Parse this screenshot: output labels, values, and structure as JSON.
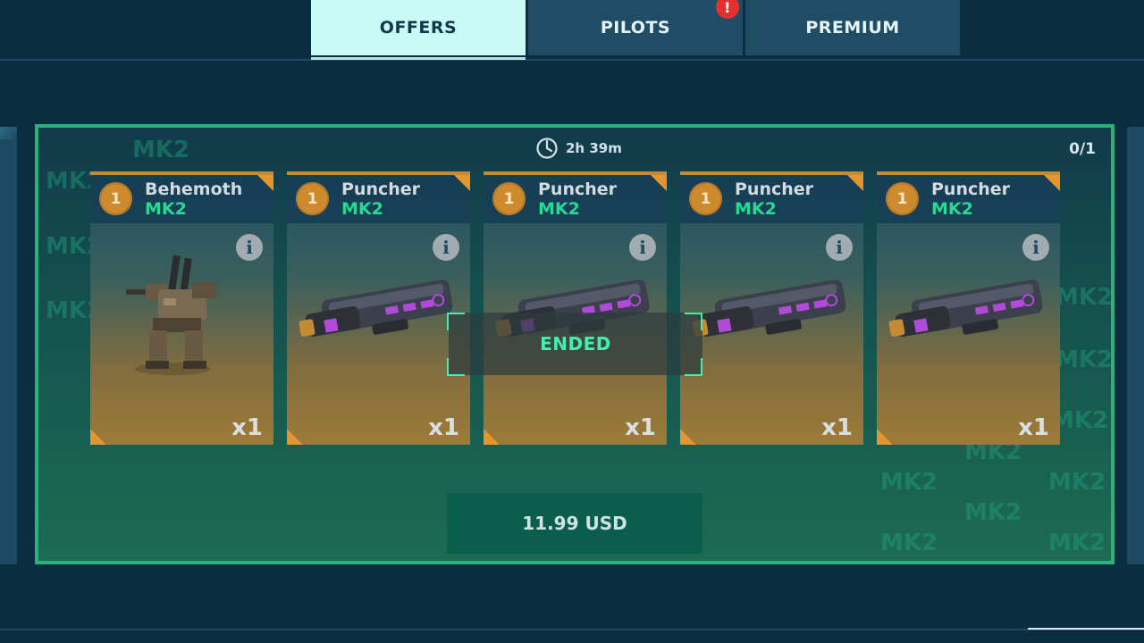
{
  "tabs": [
    {
      "label": "OFFERS",
      "active": true
    },
    {
      "label": "PILOTS",
      "active": false,
      "badge": "!"
    },
    {
      "label": "PREMIUM",
      "active": false
    }
  ],
  "offer": {
    "timer": "2h 39m",
    "counter": "0/1",
    "watermark": "MK2",
    "status": "ENDED",
    "price": "11.99 USD",
    "items": [
      {
        "level": "1",
        "name": "Behemoth",
        "tier": "MK2",
        "quantity": "x1",
        "kind": "robot"
      },
      {
        "level": "1",
        "name": "Puncher",
        "tier": "MK2",
        "quantity": "x1",
        "kind": "weapon"
      },
      {
        "level": "1",
        "name": "Puncher",
        "tier": "MK2",
        "quantity": "x1",
        "kind": "weapon"
      },
      {
        "level": "1",
        "name": "Puncher",
        "tier": "MK2",
        "quantity": "x1",
        "kind": "weapon"
      },
      {
        "level": "1",
        "name": "Puncher",
        "tier": "MK2",
        "quantity": "x1",
        "kind": "weapon"
      }
    ]
  },
  "colors": {
    "accent_green": "#2bb27c",
    "tier_green": "#27d993",
    "ended_text": "#3ff0b2",
    "rarity_orange": "#e3962f",
    "alert_red": "#e63030"
  }
}
